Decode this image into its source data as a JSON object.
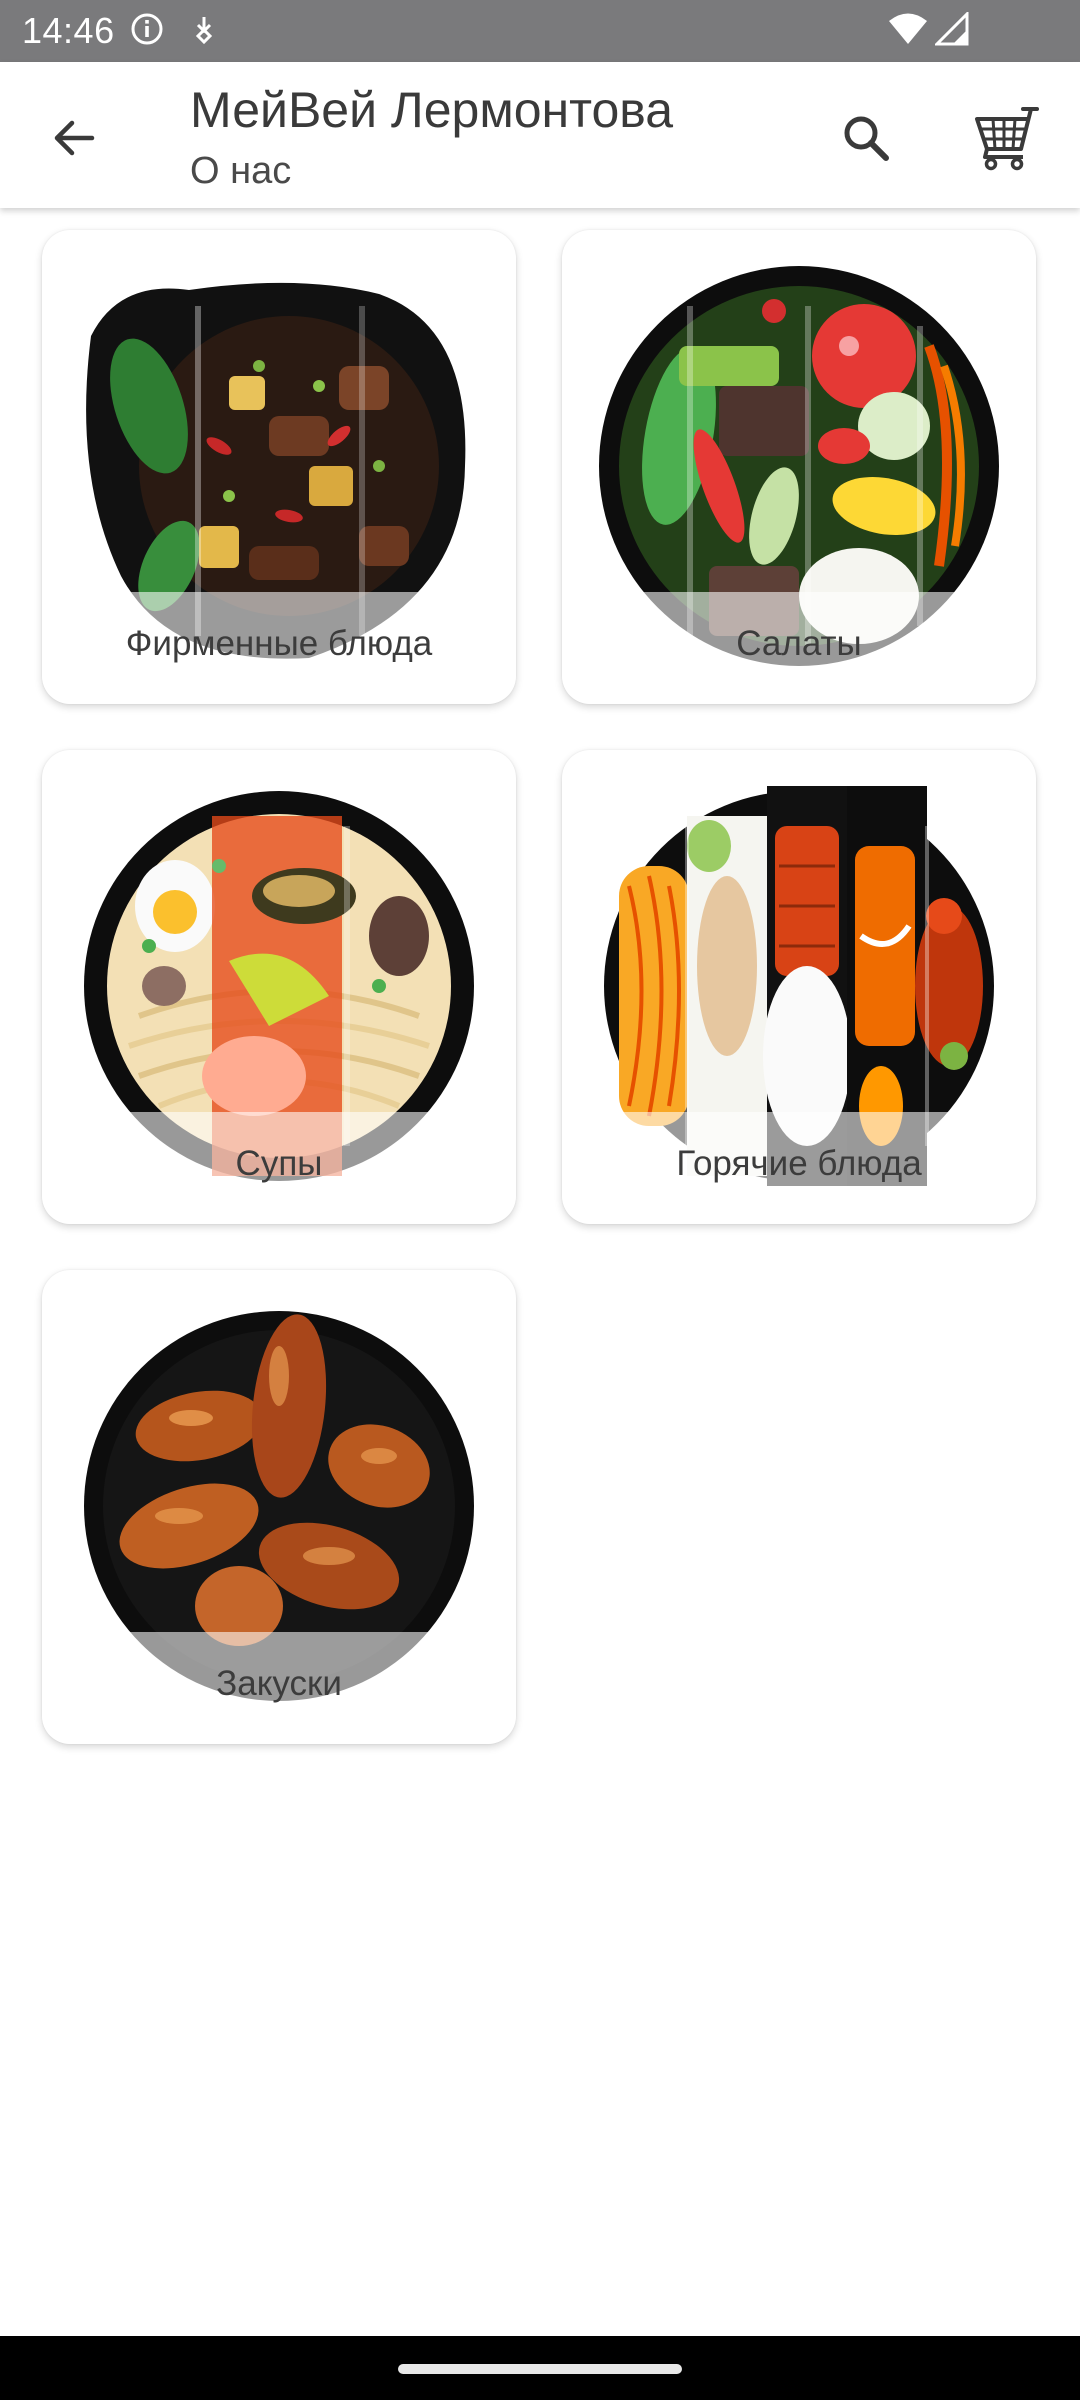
{
  "status_bar": {
    "time": "14:46",
    "icons": [
      "info-icon",
      "sim-download-icon",
      "wifi-icon",
      "signal-icon"
    ]
  },
  "app_bar": {
    "title": "МейВей Лермонтова",
    "subtitle": "О нас",
    "icons": [
      "arrow-back-icon",
      "search-icon",
      "cart-icon"
    ]
  },
  "categories": [
    {
      "label": "Фирменные блюда",
      "image": "signature-dishes-bowl"
    },
    {
      "label": "Салаты",
      "image": "salads-bowl"
    },
    {
      "label": "Супы",
      "image": "soups-bowl"
    },
    {
      "label": "Горячие блюда",
      "image": "hot-dishes-bowl"
    },
    {
      "label": "Закуски",
      "image": "appetizers-bowl"
    }
  ],
  "colors": {
    "status_bar": "#7a7a7c",
    "text_primary": "#3a3a3a",
    "nav_bar": "#000000"
  }
}
